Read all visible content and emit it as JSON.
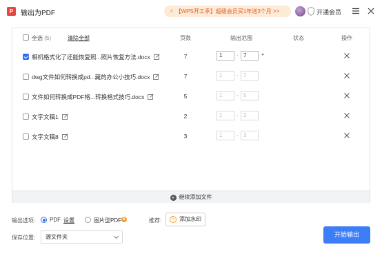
{
  "titlebar": {
    "app_logo": "P",
    "title": "输出为PDF",
    "promo": "【WPS开工季】超级会员买1年送3个月 >>",
    "vip_label": "开通会员"
  },
  "table": {
    "select_all_label": "全选",
    "select_all_count": "(5)",
    "clear_all": "清除全部",
    "headers": {
      "pages": "页数",
      "range": "输出范围",
      "status": "状态",
      "action": "操作"
    },
    "range_separator": "-",
    "rows": [
      {
        "name": "相机格式化了还能恢复照...照片恢复方法.docx",
        "checked": true,
        "pages": "7",
        "from": "1",
        "to": "7"
      },
      {
        "name": "dwg文件如何转换成pd...藏的办公小技巧.docx",
        "checked": false,
        "pages": "7",
        "from": "1",
        "to": "7"
      },
      {
        "name": "文件如何转换成PDF格...转换格式技巧.docx",
        "checked": false,
        "pages": "5",
        "from": "1",
        "to": "5"
      },
      {
        "name": "文字文稿1",
        "checked": false,
        "pages": "2",
        "from": "1",
        "to": "2"
      },
      {
        "name": "文字文稿8",
        "checked": false,
        "pages": "3",
        "from": "1",
        "to": "3"
      }
    ],
    "add_files": "继续添加文件"
  },
  "options": {
    "output_label": "输出选项:",
    "pdf_label": "PDF",
    "settings_link": "设置",
    "image_pdf_label": "图片型PDF",
    "recommend_label": "推荐:",
    "watermark_button": "添加水印",
    "save_label": "保存位置:",
    "save_location": "源文件夹",
    "start_button": "开始输出"
  },
  "colors": {
    "accent": "#3d7ef6",
    "promo_bg": "#fdebd7",
    "promo_text": "#e0602a",
    "logo": "#e8453c"
  }
}
